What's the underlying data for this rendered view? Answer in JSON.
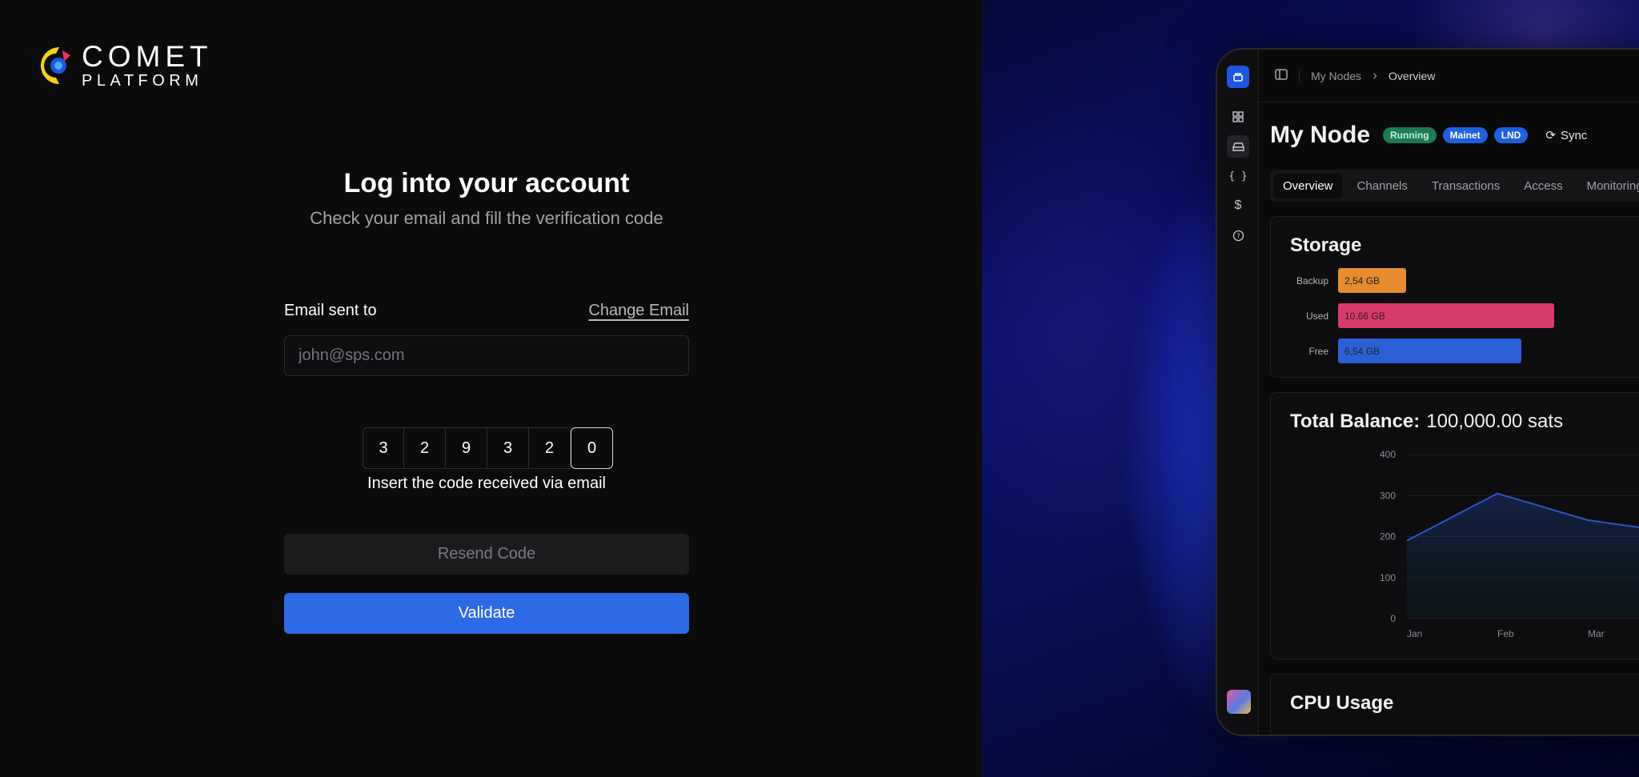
{
  "brand": {
    "line1": "COMET",
    "line2": "PLATFORM"
  },
  "login": {
    "title": "Log into your account",
    "subtitle": "Check your email and fill the verification code",
    "email_label": "Email sent to",
    "change_email": "Change Email",
    "email_placeholder": "john@sps.com",
    "code_digits": [
      "3",
      "2",
      "9",
      "3",
      "2",
      "0"
    ],
    "code_hint": "Insert the code received via email",
    "resend_label": "Resend Code",
    "validate_label": "Validate"
  },
  "preview": {
    "breadcrumb": [
      "My Nodes",
      "Overview"
    ],
    "node_title": "My Node",
    "badges": [
      "Running",
      "Mainet",
      "LND"
    ],
    "sync_label": "Sync",
    "tabs": [
      "Overview",
      "Channels",
      "Transactions",
      "Access",
      "Monitoring"
    ],
    "storage": {
      "title": "Storage",
      "rows": [
        {
          "label": "Backup",
          "value": "2,54 GB",
          "color": "#e88a2e"
        },
        {
          "label": "Used",
          "value": "10,66 GB",
          "color": "#d93a6c"
        },
        {
          "label": "Free",
          "value": "6,54 GB",
          "color": "#2a5fd6"
        }
      ]
    },
    "balance": {
      "title": "Total Balance:",
      "amount": "100,000.00 sats"
    },
    "cpu_title": "CPU Usage"
  },
  "chart_data": {
    "type": "area",
    "categories": [
      "Jan",
      "Feb",
      "Mar"
    ],
    "series": [
      {
        "values": [
          190,
          305,
          240
        ]
      }
    ],
    "ylim": [
      0,
      400
    ],
    "yticks": [
      "400",
      "300",
      "200",
      "100",
      "0"
    ]
  },
  "colors": {
    "accent": "#2f6ae6",
    "brand_icon": "#1e55e6"
  }
}
